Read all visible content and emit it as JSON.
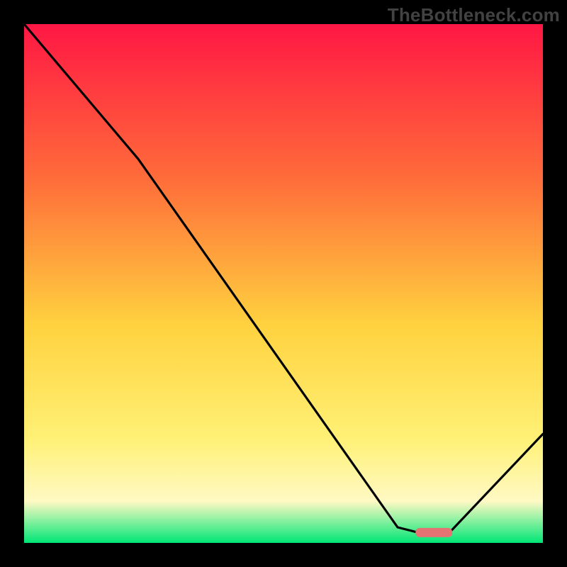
{
  "watermark": "TheBottleneck.com",
  "colors": {
    "background": "#000000",
    "gradient_top": "#ff1744",
    "gradient_upper_mid": "#ff6d3a",
    "gradient_mid": "#ffd23f",
    "gradient_lower_mid": "#fff176",
    "gradient_low": "#fff9c4",
    "gradient_bottom": "#00e676",
    "curve": "#000000",
    "marker": "#e57373"
  },
  "chart_data": {
    "type": "line",
    "title": "",
    "xlabel": "",
    "ylabel": "",
    "xlim": [
      0,
      100
    ],
    "ylim": [
      0,
      100
    ],
    "series": [
      {
        "name": "bottleneck-curve",
        "x": [
          0,
          22,
          72,
          76,
          82,
          100
        ],
        "values": [
          100,
          74,
          3,
          2,
          2,
          21
        ]
      }
    ],
    "marker": {
      "x_start": 76,
      "x_end": 82,
      "y": 2
    }
  }
}
